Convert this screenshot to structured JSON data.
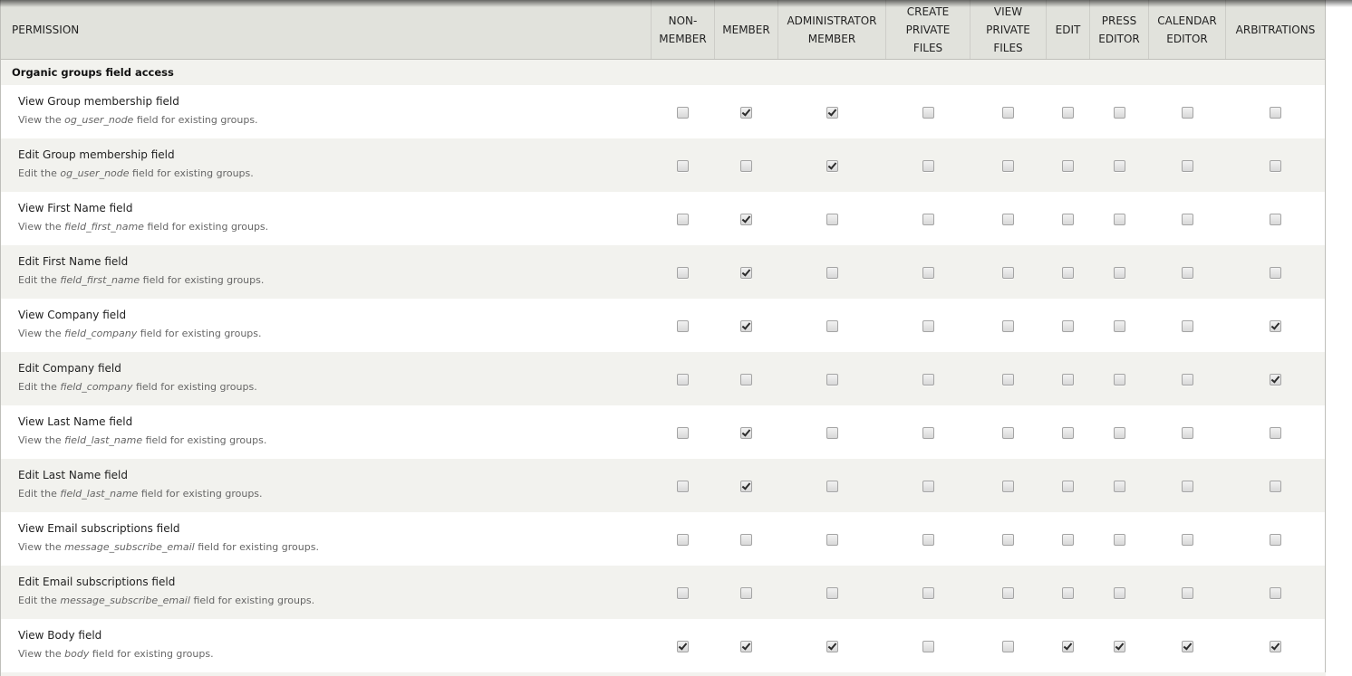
{
  "table": {
    "permission_header": "Permission",
    "roles": [
      "Non-member",
      "Member",
      "Administrator member",
      "Create private files",
      "View private files",
      "Edit",
      "Press editor",
      "Calendar editor",
      "Arbitrations"
    ],
    "category": "Organic groups field access",
    "rows": [
      {
        "title": "View Group membership field",
        "desc_prefix": "View the",
        "field": "og_user_node",
        "desc_suffix": "field for existing groups.",
        "checks": [
          false,
          true,
          true,
          false,
          false,
          false,
          false,
          false,
          false
        ]
      },
      {
        "title": "Edit Group membership field",
        "desc_prefix": "Edit the",
        "field": "og_user_node",
        "desc_suffix": "field for existing groups.",
        "checks": [
          false,
          false,
          true,
          false,
          false,
          false,
          false,
          false,
          false
        ]
      },
      {
        "title": "View First Name field",
        "desc_prefix": "View the",
        "field": "field_first_name",
        "desc_suffix": "field for existing groups.",
        "checks": [
          false,
          true,
          false,
          false,
          false,
          false,
          false,
          false,
          false
        ]
      },
      {
        "title": "Edit First Name field",
        "desc_prefix": "Edit the",
        "field": "field_first_name",
        "desc_suffix": "field for existing groups.",
        "checks": [
          false,
          true,
          false,
          false,
          false,
          false,
          false,
          false,
          false
        ]
      },
      {
        "title": "View Company field",
        "desc_prefix": "View the",
        "field": "field_company",
        "desc_suffix": "field for existing groups.",
        "checks": [
          false,
          true,
          false,
          false,
          false,
          false,
          false,
          false,
          true
        ]
      },
      {
        "title": "Edit Company field",
        "desc_prefix": "Edit the",
        "field": "field_company",
        "desc_suffix": "field for existing groups.",
        "checks": [
          false,
          false,
          false,
          false,
          false,
          false,
          false,
          false,
          true
        ]
      },
      {
        "title": "View Last Name field",
        "desc_prefix": "View the",
        "field": "field_last_name",
        "desc_suffix": "field for existing groups.",
        "checks": [
          false,
          true,
          false,
          false,
          false,
          false,
          false,
          false,
          false
        ]
      },
      {
        "title": "Edit Last Name field",
        "desc_prefix": "Edit the",
        "field": "field_last_name",
        "desc_suffix": "field for existing groups.",
        "checks": [
          false,
          true,
          false,
          false,
          false,
          false,
          false,
          false,
          false
        ]
      },
      {
        "title": "View Email subscriptions field",
        "desc_prefix": "View the",
        "field": "message_subscribe_email",
        "desc_suffix": "field for existing groups.",
        "checks": [
          false,
          false,
          false,
          false,
          false,
          false,
          false,
          false,
          false
        ]
      },
      {
        "title": "Edit Email subscriptions field",
        "desc_prefix": "Edit the",
        "field": "message_subscribe_email",
        "desc_suffix": "field for existing groups.",
        "checks": [
          false,
          false,
          false,
          false,
          false,
          false,
          false,
          false,
          false
        ]
      },
      {
        "title": "View Body field",
        "desc_prefix": "View the",
        "field": "body",
        "desc_suffix": "field for existing groups.",
        "checks": [
          true,
          true,
          true,
          false,
          false,
          true,
          true,
          true,
          true
        ]
      }
    ]
  }
}
